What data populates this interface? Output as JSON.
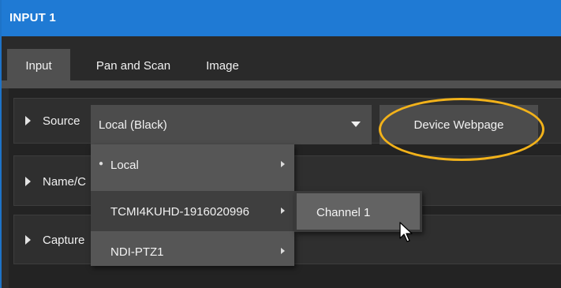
{
  "window": {
    "title": "INPUT 1"
  },
  "tabs": [
    {
      "label": "Input",
      "active": true
    },
    {
      "label": "Pan and Scan",
      "active": false
    },
    {
      "label": "Image",
      "active": false
    }
  ],
  "rows": {
    "source": {
      "label": "Source"
    },
    "name": {
      "label": "Name/C"
    },
    "capture": {
      "label": "Capture"
    }
  },
  "source_select": {
    "value": "Local (Black)"
  },
  "device_webpage_button": {
    "label": "Device Webpage"
  },
  "dropdown_menu": {
    "items": [
      {
        "label": "Local",
        "selected": true,
        "has_submenu": true
      },
      {
        "label": "TCMI4KUHD-1916020996",
        "selected": false,
        "has_submenu": true,
        "highlighted": true
      },
      {
        "label": "NDI-PTZ1",
        "selected": false,
        "has_submenu": true
      }
    ]
  },
  "submenu": {
    "items": [
      {
        "label": "Channel 1"
      }
    ]
  },
  "colors": {
    "titlebar": "#1f7ad4",
    "highlight_ring": "#f2b21a",
    "panel_bg": "#232323",
    "control_bg": "#4c4c4c"
  },
  "icons": {
    "expand": "triangle-right-icon",
    "dropdown": "caret-down-icon",
    "submenu": "chevron-right-icon",
    "pointer": "mouse-cursor-icon"
  }
}
